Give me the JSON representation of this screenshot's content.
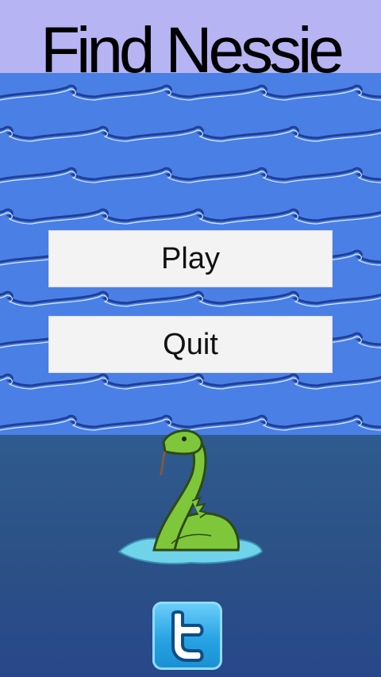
{
  "game": {
    "title": "Find Nessie"
  },
  "menu": {
    "play_label": "Play",
    "quit_label": "Quit"
  },
  "colors": {
    "sky": "#b6b4f3",
    "sea": "#4a7fe5",
    "deep_water": "#2b4f86",
    "button": "#f3f3f3",
    "nessie": "#7ec73a",
    "twitter": "#28a3e3"
  },
  "icons": {
    "share": "twitter-icon",
    "character": "nessie-icon"
  }
}
